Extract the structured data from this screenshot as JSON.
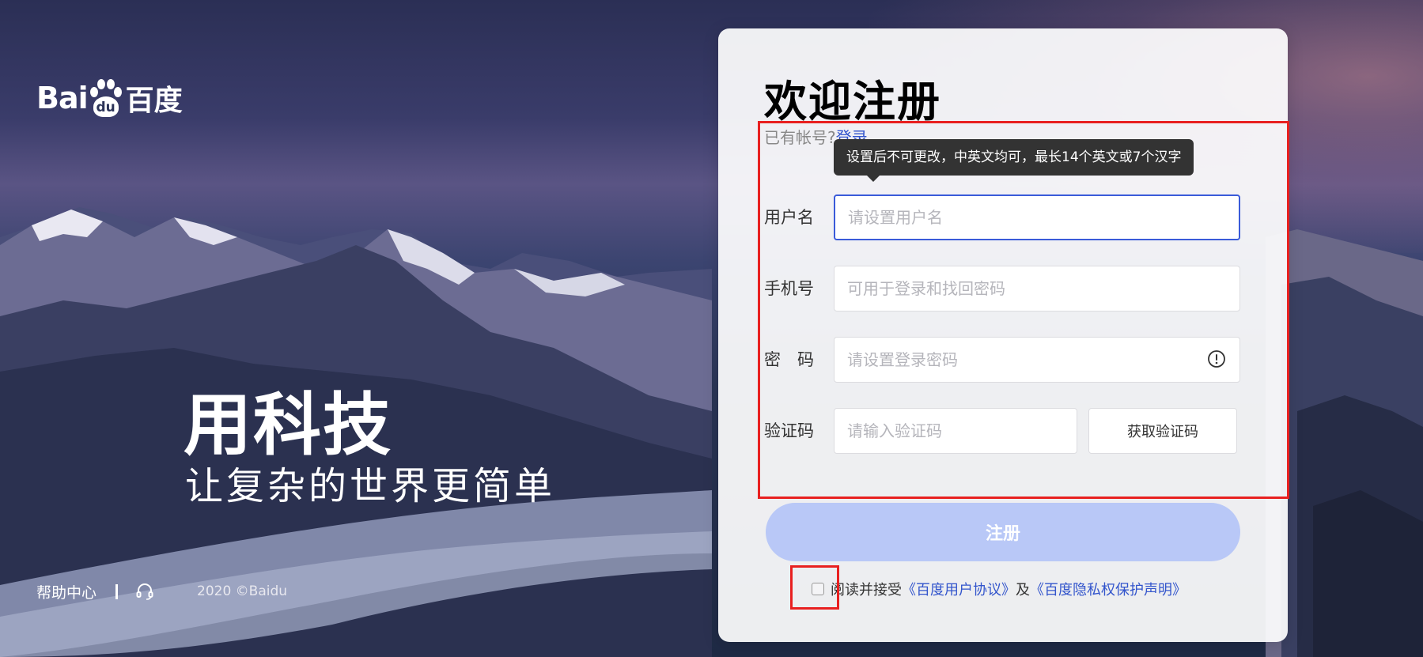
{
  "brand": {
    "logo_latin": "Bai",
    "logo_paw_text": "du",
    "logo_chinese": "百度"
  },
  "slogan": {
    "main": "用科技",
    "sub": "让复杂的世界更简单"
  },
  "footer": {
    "help_center": "帮助中心",
    "copyright": "2020 ©Baidu"
  },
  "form": {
    "title": "欢迎注册",
    "have_account_text": "已有帐号?",
    "login_link": "登录",
    "username_tooltip": "设置后不可更改，中英文均可，最长14个英文或7个汉字",
    "username": {
      "label": "用户名",
      "placeholder": "请设置用户名",
      "value": ""
    },
    "phone": {
      "label": "手机号",
      "placeholder": "可用于登录和找回密码",
      "value": ""
    },
    "password": {
      "label": "密　码",
      "placeholder": "请设置登录密码",
      "value": ""
    },
    "verify_code": {
      "label": "验证码",
      "placeholder": "请输入验证码",
      "value": ""
    },
    "get_code_button": "获取验证码",
    "submit_button": "注册",
    "agreement": {
      "prefix": "阅读并接受",
      "user_agreement": "《百度用户协议》",
      "conjunction": "及",
      "privacy_statement": "《百度隐私权保护声明》",
      "checked": false
    }
  },
  "colors": {
    "accent": "#3a5bd9",
    "submit_disabled": "#b9c8f7",
    "highlight": "#e82020",
    "tooltip_bg": "#333333"
  }
}
